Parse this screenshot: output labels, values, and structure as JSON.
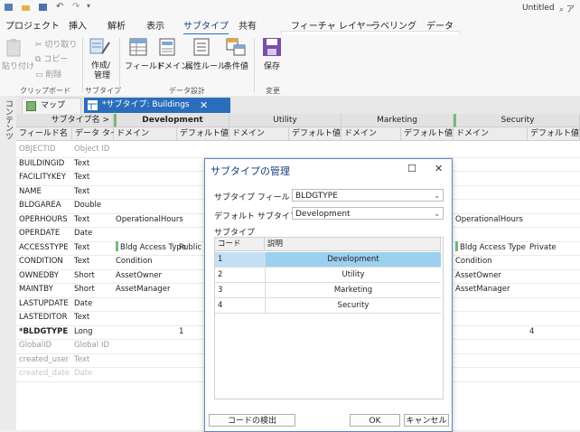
{
  "window": {
    "title": "Untitled",
    "search_label": "ア"
  },
  "ribbon_tabs": [
    {
      "label": "プロジェクト"
    },
    {
      "label": "挿入"
    },
    {
      "label": "解析"
    },
    {
      "label": "表示"
    },
    {
      "label": "サブタイプ",
      "active": true
    },
    {
      "label": "共有"
    },
    {
      "label": "フィーチャ レイヤー"
    },
    {
      "label": "ラベリング"
    },
    {
      "label": "データ"
    }
  ],
  "ribbon": {
    "paste": "貼り付け",
    "cut": "切り取り",
    "copy": "コピー",
    "delete": "削除",
    "group_clipboard": "クリップボード",
    "create_manage_1": "作成/",
    "create_manage_2": "管理",
    "group_subtype": "サブタイプ",
    "field": "フィールド",
    "domain": "ドメイン",
    "attr_rule": "属性ルール",
    "cond_value": "条件値",
    "group_data_design": "データ設計",
    "save": "保存",
    "group_changes": "変更"
  },
  "side_panel_label": "コンテンツ",
  "view_tabs": {
    "map": "マップ",
    "subtype": "*サブタイプ: Buildings"
  },
  "table": {
    "subtype_name_label": "サブタイプ名 >",
    "subtypes": [
      "Development",
      "Utility",
      "Marketing",
      "Security"
    ],
    "col_field": "フィールド名",
    "col_type": "データ タイプ",
    "col_domain": "ドメイン",
    "col_default": "デフォルト値",
    "rows": [
      {
        "field": "OBJECTID",
        "type": "Object ID",
        "muted": true
      },
      {
        "field": "BUILDINGID",
        "type": "Text"
      },
      {
        "field": "FACILITYKEY",
        "type": "Text"
      },
      {
        "field": "NAME",
        "type": "Text"
      },
      {
        "field": "BLDGAREA",
        "type": "Double"
      },
      {
        "field": "OPERHOURS",
        "type": "Text",
        "dev_domain": "OperationalHours",
        "sec_domain": "OperationalHours"
      },
      {
        "field": "OPERDATE",
        "type": "Date"
      },
      {
        "field": "ACCESSTYPE",
        "type": "Text",
        "dev_domain": "Bldg Access Type",
        "dev_default": "Public",
        "sec_domain": "Bldg Access Type",
        "sec_default": "Private"
      },
      {
        "field": "CONDITION",
        "type": "Text",
        "dev_domain": "Condition",
        "sec_domain": "Condition"
      },
      {
        "field": "OWNEDBY",
        "type": "Short",
        "dev_domain": "AssetOwner",
        "sec_domain": "AssetOwner"
      },
      {
        "field": "MAINTBY",
        "type": "Short",
        "dev_domain": "AssetManager",
        "sec_domain": "AssetManager"
      },
      {
        "field": "LASTUPDATE",
        "type": "Date"
      },
      {
        "field": "LASTEDITOR",
        "type": "Text"
      },
      {
        "field": "*BLDGTYPE",
        "type": "Long",
        "dev_default": "1",
        "sec_default": "4",
        "bold": true
      },
      {
        "field": "GlobalID",
        "type": "Global ID",
        "muted": true
      },
      {
        "field": "created_user",
        "type": "Text",
        "muted": true
      },
      {
        "field": "created_date",
        "type": "Date",
        "faint": true
      }
    ]
  },
  "dialog": {
    "title": "サブタイプの管理",
    "subtype_field_label": "サブタイプ フィールド:",
    "subtype_field_value": "BLDGTYPE",
    "default_subtype_label": "デフォルト サブタイプ:",
    "default_subtype_value": "Development",
    "subtypes_group": "サブタイプ",
    "col_code": "コード",
    "col_desc": "説明",
    "subtypes": [
      {
        "code": "1",
        "desc": "Development",
        "selected": true
      },
      {
        "code": "2",
        "desc": "Utility"
      },
      {
        "code": "3",
        "desc": "Marketing"
      },
      {
        "code": "4",
        "desc": "Security"
      }
    ],
    "detect_codes": "コードの検出",
    "ok": "OK",
    "cancel": "キャンセル"
  },
  "colors": {
    "accent": "#2a6ebb",
    "selected_row": "#9ccff0",
    "title_text": "#1a3f7a"
  }
}
